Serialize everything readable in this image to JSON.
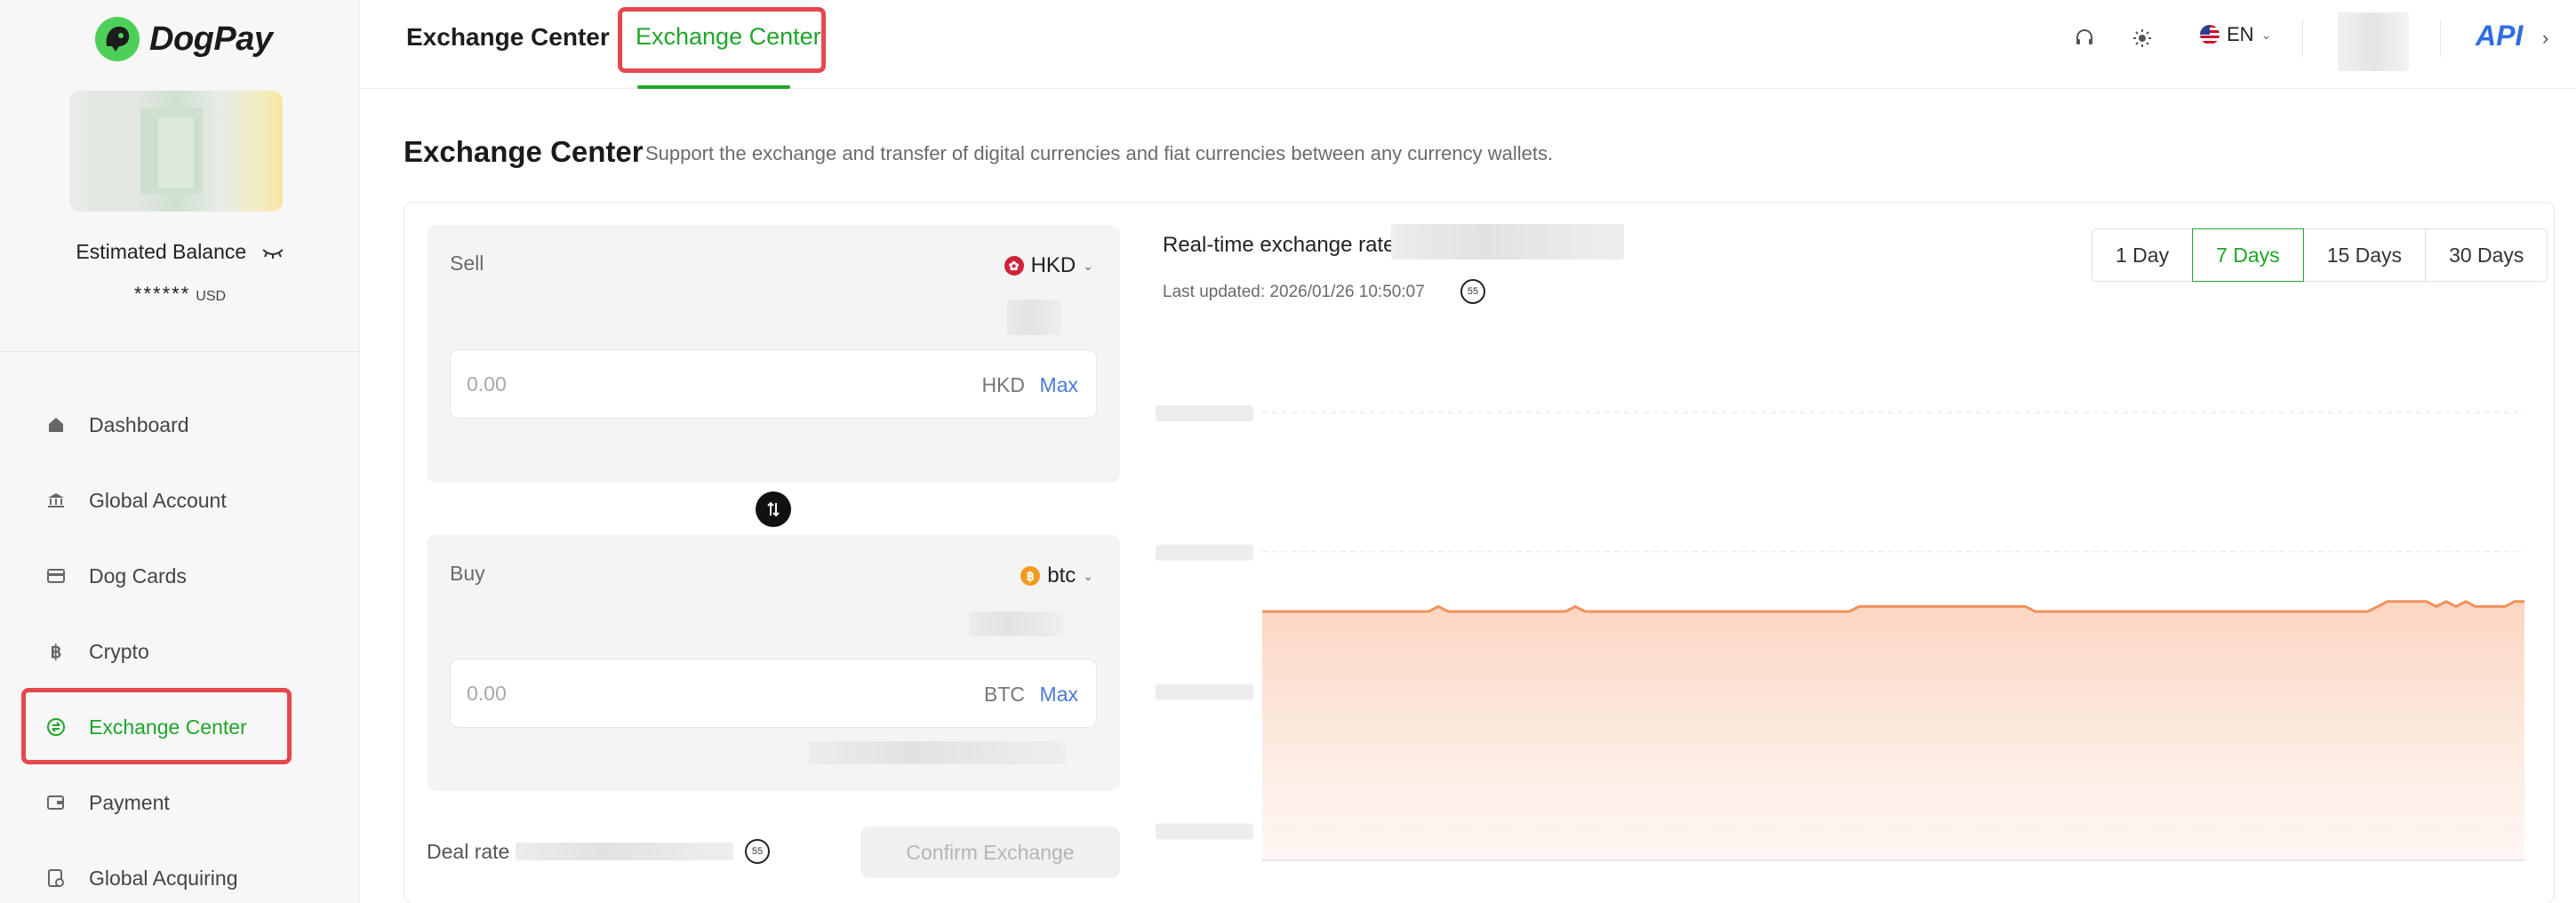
{
  "brand": {
    "name": "DogPay"
  },
  "sidebar": {
    "balance_label": "Estimated Balance",
    "balance_masked": "******",
    "balance_currency": "USD",
    "items": [
      {
        "label": "Dashboard",
        "icon": "home-icon"
      },
      {
        "label": "Global Account",
        "icon": "bank-icon"
      },
      {
        "label": "Dog Cards",
        "icon": "card-icon"
      },
      {
        "label": "Crypto",
        "icon": "bitcoin-icon"
      },
      {
        "label": "Exchange Center",
        "icon": "exchange-icon",
        "active": true
      },
      {
        "label": "Payment",
        "icon": "wallet-icon"
      },
      {
        "label": "Global Acquiring",
        "icon": "acquiring-icon"
      }
    ]
  },
  "header": {
    "title": "Exchange Center",
    "active_tab": "Exchange Center",
    "language": "EN",
    "api_label": "API"
  },
  "page": {
    "title": "Exchange Center",
    "subtitle": "Support the exchange and transfer of digital currencies and fiat currencies between any currency wallets."
  },
  "sell": {
    "label": "Sell",
    "currency": "HKD",
    "placeholder": "0.00",
    "unit": "HKD",
    "max_label": "Max"
  },
  "buy": {
    "label": "Buy",
    "currency": "btc",
    "placeholder": "0.00",
    "unit": "BTC",
    "max_label": "Max"
  },
  "deal": {
    "label": "Deal rate",
    "timer": "55",
    "confirm_label": "Confirm Exchange"
  },
  "rate": {
    "label": "Real-time exchange rate:",
    "updated": "Last updated: 2026/01/26 10:50:07",
    "timer": "55",
    "ranges": [
      "1 Day",
      "7 Days",
      "15 Days",
      "30 Days"
    ],
    "active_range": "7 Days"
  },
  "colors": {
    "accent_green": "#1fa52a",
    "link_blue": "#4a7bd5",
    "api_blue": "#2f6de1",
    "chart_line": "#f0925c",
    "highlight_red": "#e5484d"
  },
  "chart_data": {
    "type": "area",
    "values": [
      0.5,
      0.5,
      0.5,
      0.5,
      0.5,
      0.5,
      0.5,
      0.5,
      0.5,
      0.5,
      0.5,
      0.5,
      0.5,
      0.5,
      0.5,
      0.5,
      0.5,
      0.5,
      0.51,
      0.5,
      0.5,
      0.5,
      0.5,
      0.5,
      0.5,
      0.5,
      0.5,
      0.5,
      0.5,
      0.5,
      0.5,
      0.5,
      0.51,
      0.5,
      0.5,
      0.5,
      0.5,
      0.5,
      0.5,
      0.5,
      0.5,
      0.5,
      0.5,
      0.5,
      0.5,
      0.5,
      0.5,
      0.5,
      0.5,
      0.5,
      0.5,
      0.5,
      0.5,
      0.5,
      0.5,
      0.5,
      0.5,
      0.5,
      0.5,
      0.5,
      0.5,
      0.51,
      0.51,
      0.51,
      0.51,
      0.51,
      0.51,
      0.51,
      0.51,
      0.51,
      0.51,
      0.51,
      0.51,
      0.51,
      0.51,
      0.51,
      0.51,
      0.51,
      0.51,
      0.5,
      0.5,
      0.5,
      0.5,
      0.5,
      0.5,
      0.5,
      0.5,
      0.5,
      0.5,
      0.5,
      0.5,
      0.5,
      0.5,
      0.5,
      0.5,
      0.5,
      0.5,
      0.5,
      0.5,
      0.5,
      0.5,
      0.5,
      0.5,
      0.5,
      0.5,
      0.5,
      0.5,
      0.5,
      0.5,
      0.5,
      0.5,
      0.5,
      0.5,
      0.5,
      0.51,
      0.52,
      0.52,
      0.52,
      0.52,
      0.52,
      0.51,
      0.52,
      0.51,
      0.52,
      0.51,
      0.51,
      0.51,
      0.51,
      0.52,
      0.52
    ],
    "ylim": [
      0,
      1
    ],
    "grid": true,
    "xlabel": "",
    "ylabel": ""
  }
}
